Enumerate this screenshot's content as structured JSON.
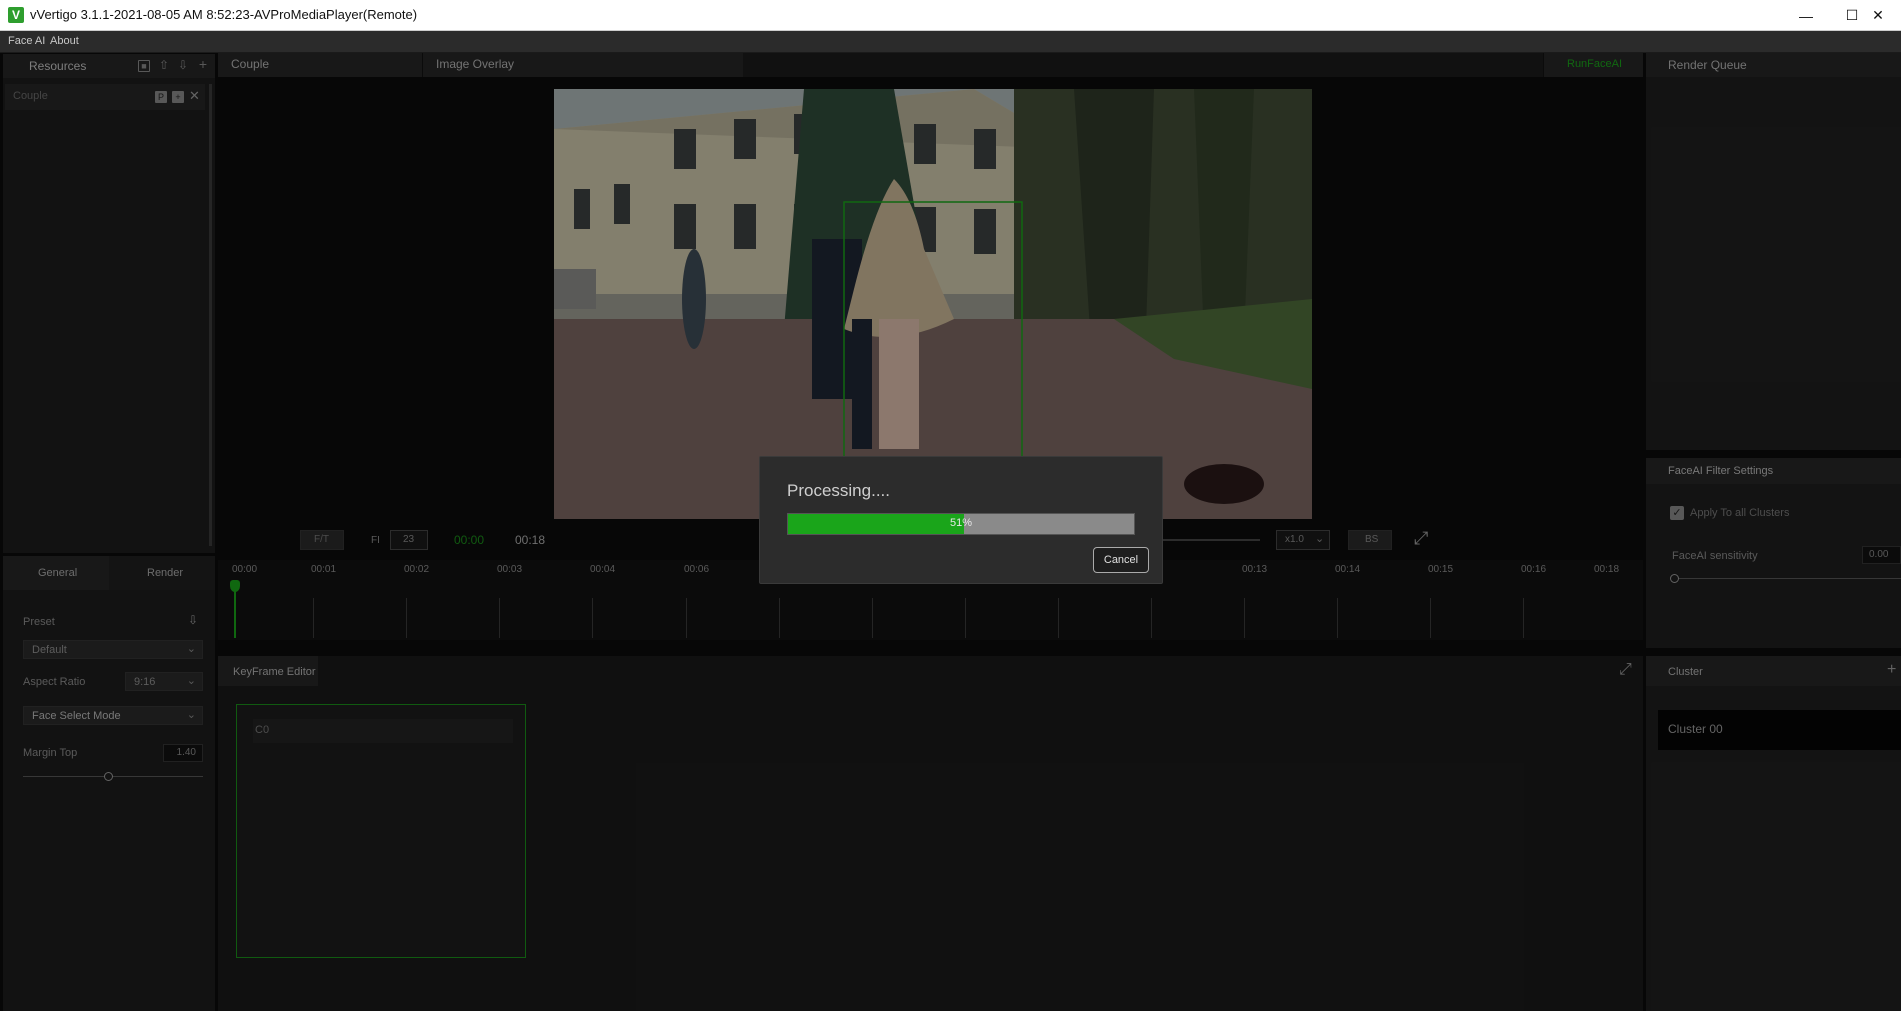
{
  "window": {
    "title": "vVertigo 3.1.1-2021-08-05 AM 8:52:23-AVProMediaPlayer(Remote)",
    "app_icon_letter": "V"
  },
  "menu": {
    "items": [
      "Face AI",
      "About"
    ]
  },
  "resources": {
    "title": "Resources",
    "item": "Couple"
  },
  "tabs": {
    "couple": "Couple",
    "image_overlay": "Image Overlay",
    "run_faceai": "RunFaceAI",
    "render_queue": "Render Queue"
  },
  "playback": {
    "ft_label": "F/T",
    "fi_label": "FI",
    "fi_value": "23",
    "current_time": "00:00",
    "total_time": "00:18",
    "speed": "x1.0",
    "bs_label": "BS"
  },
  "timeline": {
    "labels": [
      "00:00",
      "00:01",
      "00:02",
      "00:03",
      "00:04",
      "00:06",
      "00:13",
      "00:14",
      "00:15",
      "00:16",
      "00:18"
    ]
  },
  "settings": {
    "tab_general": "General",
    "tab_render": "Render",
    "preset_label": "Preset",
    "preset_value": "Default",
    "aspect_label": "Aspect Ratio",
    "aspect_value": "9:16",
    "face_mode_value": "Face Select Mode",
    "margin_label": "Margin Top",
    "margin_value": "1.40",
    "margin_fraction": 0.47
  },
  "keyframe": {
    "title": "KeyFrame Editor",
    "card_label": "C0"
  },
  "filter": {
    "title": "FaceAI Filter Settings",
    "apply_all": "Apply To all Clusters",
    "sensitivity_label": "FaceAI sensitivity",
    "sensitivity_value": "0.00",
    "sensitivity_fraction": 0.0
  },
  "cluster": {
    "title": "Cluster",
    "item": "Cluster 00"
  },
  "dialog": {
    "title": "Processing....",
    "progress_text": "51%",
    "progress_fraction": 0.51,
    "cancel_label": "Cancel"
  },
  "colors": {
    "accent": "#1aa01a",
    "progress_fill": "#1aa51a",
    "title_green": "#2aaa2a"
  }
}
